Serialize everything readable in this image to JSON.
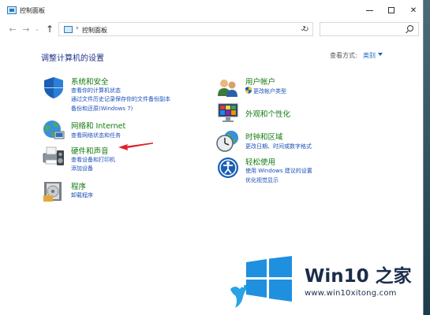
{
  "window": {
    "title": "控制面板",
    "controls": {
      "minimize": "",
      "maximize": "",
      "close": "✕"
    }
  },
  "nav": {
    "back": "←",
    "forward": "→",
    "recent": "⌄",
    "up": "↑",
    "breadcrumb_separator": "›",
    "address": "控制面板",
    "address_dropdown": "⌄",
    "refresh": "↻",
    "search_placeholder": ""
  },
  "page": {
    "title": "调整计算机的设置",
    "view_by_label": "查看方式:",
    "view_by_value": "类别"
  },
  "categories_left": [
    {
      "icon": "shield-icon",
      "title": "系统和安全",
      "links": [
        "查看你的计算机状态",
        "通过文件历史记录保存你的文件备份副本",
        "备份和还原(Windows 7)"
      ]
    },
    {
      "icon": "network-globe-icon",
      "title": "网络和 Internet",
      "links": [
        "查看网络状态和任务"
      ]
    },
    {
      "icon": "printer-speaker-icon",
      "title": "硬件和声音",
      "links": [
        "查看设备和打印机",
        "添加设备"
      ]
    },
    {
      "icon": "programs-icon",
      "title": "程序",
      "links": [
        "卸载程序"
      ]
    }
  ],
  "categories_right": [
    {
      "icon": "users-icon",
      "title": "用户帐户",
      "links": [
        "更改帐户类型"
      ]
    },
    {
      "icon": "appearance-icon",
      "title": "外观和个性化",
      "links": []
    },
    {
      "icon": "clock-globe-icon",
      "title": "时钟和区域",
      "links": [
        "更改日期、时间或数字格式"
      ]
    },
    {
      "icon": "ease-of-access-icon",
      "title": "轻松使用",
      "links": [
        "使用 Windows 建议的设置",
        "优化视觉显示"
      ]
    }
  ],
  "watermark": {
    "brand": "Win10 之家",
    "url": "www.win10xitong.com"
  },
  "colors": {
    "category_title": "#117a0f",
    "link": "#1a4fb8",
    "page_title": "#1e3287",
    "annotation_arrow": "#e0202a",
    "watermark_blue": "#1f8fe0"
  }
}
